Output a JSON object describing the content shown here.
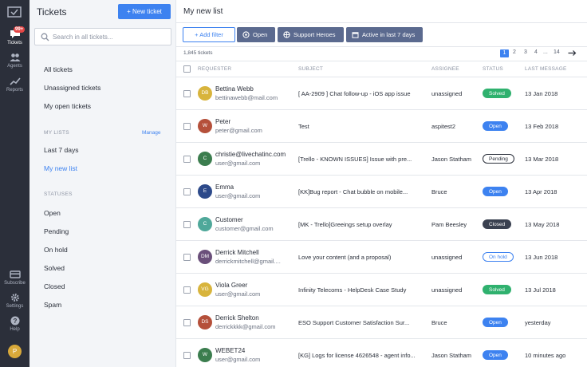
{
  "colors": {
    "accent": "#3d82f0",
    "rail_bg": "#2b2f3a",
    "chip_bg": "#5b6a8f",
    "status": {
      "Solved": {
        "bg": "#2fb16e",
        "fg": "#ffffff",
        "border": "#2fb16e"
      },
      "Open": {
        "bg": "#3d82f0",
        "fg": "#ffffff",
        "border": "#3d82f0"
      },
      "Pending": {
        "bg": "#ffffff",
        "fg": "#2a2f3a",
        "border": "#2a2f3a"
      },
      "Closed": {
        "bg": "#3a4150",
        "fg": "#ffffff",
        "border": "#3a4150"
      },
      "On hold": {
        "bg": "#ffffff",
        "fg": "#3d82f0",
        "border": "#3d82f0"
      }
    }
  },
  "rail": {
    "tickets": {
      "label": "Tickets",
      "badge": "99+",
      "icon": "chat-bubble-icon"
    },
    "agents": {
      "label": "Agents",
      "icon": "users-icon"
    },
    "reports": {
      "label": "Reports",
      "icon": "trend-chart-icon"
    },
    "subscribe": {
      "label": "Subscribe",
      "icon": "credit-card-icon"
    },
    "settings": {
      "label": "Settings",
      "icon": "gear-icon"
    },
    "help": {
      "label": "Help",
      "icon": "question-icon"
    },
    "avatar": "P"
  },
  "sidebar": {
    "title": "Tickets",
    "new_ticket": "+ New ticket",
    "search_placeholder": "Search in all tickets...",
    "views": [
      "All tickets",
      "Unassigned tickets",
      "My open tickets"
    ],
    "my_lists_heading": "MY LISTS",
    "manage": "Manage",
    "lists": [
      "Last 7 days",
      "My new list"
    ],
    "active_list": "My new list",
    "statuses_heading": "STATUSES",
    "statuses": [
      "Open",
      "Pending",
      "On hold",
      "Solved",
      "Closed",
      "Spam"
    ]
  },
  "main": {
    "title": "My new list",
    "add_filter": "+ Add filter",
    "chips": [
      "Open",
      "Support Heroes",
      "Active in last 7 days"
    ],
    "count": "1,845 tickets",
    "pagination": {
      "pages": [
        "1",
        "2",
        "3",
        "4",
        "...",
        "14"
      ],
      "current": "1"
    },
    "columns": {
      "requester": "REQUESTER",
      "subject": "SUBJECT",
      "assignee": "ASSIGNEE",
      "status": "STATUS",
      "last_message": "LAST MESSAGE"
    }
  },
  "tickets": [
    {
      "initials": "DB",
      "avatar_color": "#d8b43c",
      "name": "Bettina Webb",
      "email": "bettinawebb@mail.com",
      "subject": "[ AA-2909 ] Chat follow-up - iOS app issue",
      "assignee": "unassigned",
      "status": "Solved",
      "last": "13 Jan 2018"
    },
    {
      "initials": "W",
      "avatar_color": "#b5503a",
      "name": "Peter",
      "email": "peter@gmail.com",
      "subject": "Test",
      "assignee": "aspitest2",
      "status": "Open",
      "last": "13 Feb 2018"
    },
    {
      "initials": "C",
      "avatar_color": "#3b7d4e",
      "name": "christie@livechatinc.com",
      "email": "user@gmail.com",
      "subject": "[Trello - KNOWN ISSUES] Issue with pre...",
      "assignee": "Jason Statham",
      "status": "Pending",
      "last": "13 Mar 2018"
    },
    {
      "initials": "E",
      "avatar_color": "#2d4a8a",
      "name": "Emma",
      "email": "user@gmail.com",
      "subject": "[KK]Bug report - Chat bubble on mobile...",
      "assignee": "Bruce",
      "status": "Open",
      "last": "13 Apr 2018"
    },
    {
      "initials": "C",
      "avatar_color": "#4fa89a",
      "name": "Customer",
      "email": "customer@gmail.com",
      "subject": "[MK - Trello]Greeings setup overlay",
      "assignee": "Pam Beesley",
      "status": "Closed",
      "last": "13 May 2018"
    },
    {
      "initials": "DM",
      "avatar_color": "#6a4f7a",
      "name": "Derrick Mitchell",
      "email": "derrickmitchell@gmail....",
      "subject": "Love your content (and a proposal)",
      "assignee": "unassigned",
      "status": "On hold",
      "last": "13 Jun 2018"
    },
    {
      "initials": "VG",
      "avatar_color": "#d8b43c",
      "name": "Viola Greer",
      "email": "user@gmail.com",
      "subject": "Infinity Telecoms - HelpDesk Case Study",
      "assignee": "unassigned",
      "status": "Solved",
      "last": "13 Jul 2018"
    },
    {
      "initials": "DS",
      "avatar_color": "#b5503a",
      "name": "Derrick Shelton",
      "email": "derrickkkk@gmail.com",
      "subject": "ESO Support Customer Satisfaction Sur...",
      "assignee": "Bruce",
      "status": "Open",
      "last": "yesterday"
    },
    {
      "initials": "W",
      "avatar_color": "#3b7d4e",
      "name": "WEBET24",
      "email": "user@gmail.com",
      "subject": "[KG] Logs for license 4626548 - agent info...",
      "assignee": "Jason Statham",
      "status": "Open",
      "last": "10 minutes ago"
    }
  ]
}
